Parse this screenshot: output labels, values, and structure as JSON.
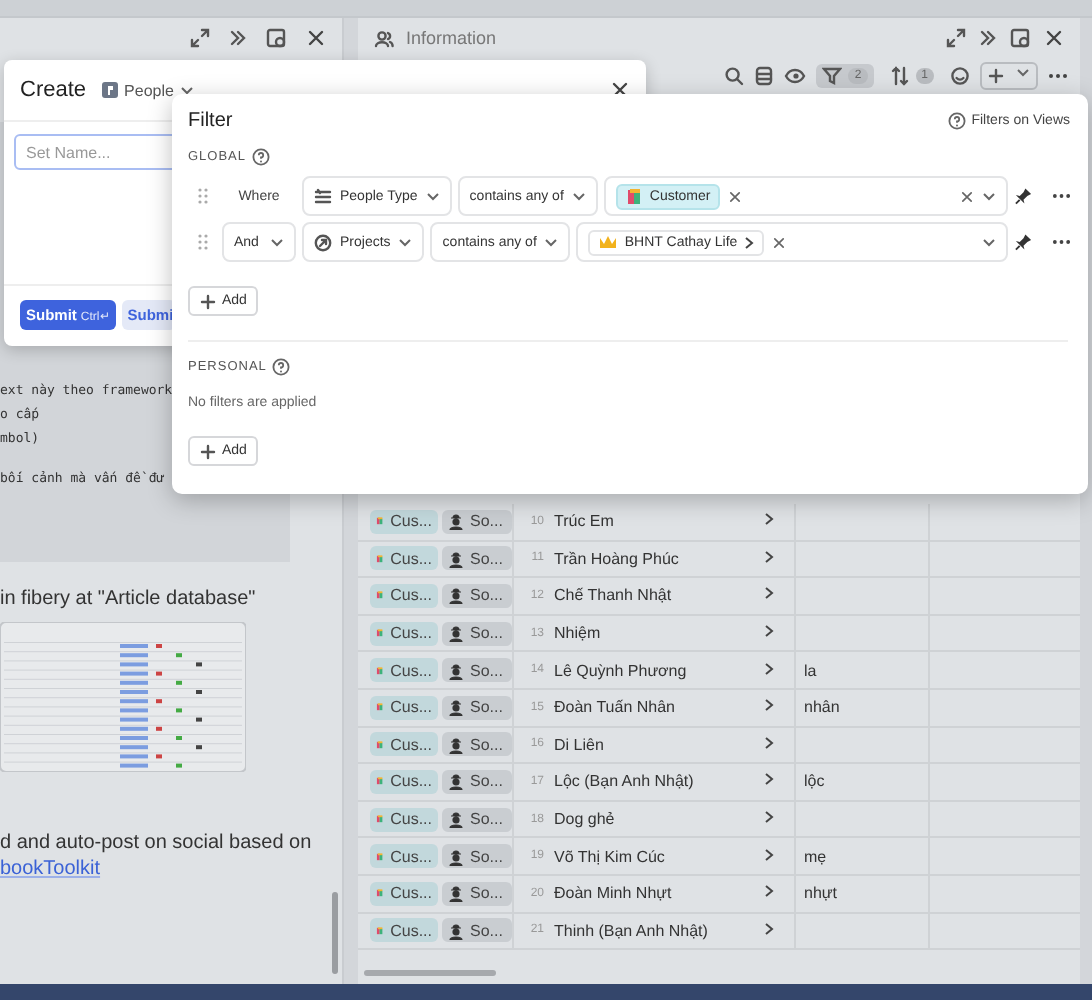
{
  "left_panel": {
    "code_lines": [
      "ext này theo framework",
      "o cấp",
      "mbol)",
      "bối cảnh mà vấn đề đư"
    ],
    "paragraph_top": "in fibery at \"Article database\"",
    "paragraph_bottom": "d and auto-post on social based on",
    "link": "bookToolkit"
  },
  "right_panel": {
    "title": "Information",
    "filter_count": "2",
    "sort_count": "1",
    "rows": [
      {
        "chips": [
          "Cus...",
          "So..."
        ],
        "number": "10",
        "name": "Trúc Em"
      },
      {
        "chips": [
          "Cus...",
          "So..."
        ],
        "number": "11",
        "name": "Trần Hoàng Phúc"
      },
      {
        "chips": [
          "Cus...",
          "So..."
        ],
        "number": "12",
        "name": "Chế Thanh Nhật"
      },
      {
        "chips": [
          "Cus...",
          "So..."
        ],
        "number": "13",
        "name": "Nhiệm"
      },
      {
        "chips": [
          "Cus...",
          "So..."
        ],
        "number": "14",
        "name": "Lê Quỳnh Phương",
        "note": "la"
      },
      {
        "chips": [
          "Cus...",
          "So..."
        ],
        "number": "15",
        "name": "Đoàn Tuấn Nhân",
        "note": "nhân"
      },
      {
        "chips": [
          "Cus...",
          "So..."
        ],
        "number": "16",
        "name": "Di Liên"
      },
      {
        "chips": [
          "Cus...",
          "So..."
        ],
        "number": "17",
        "name": "Lộc (Bạn Anh Nhật)",
        "note": "lộc"
      },
      {
        "chips": [
          "Cus...",
          "So..."
        ],
        "number": "18",
        "name": "Dog ghẻ"
      },
      {
        "chips": [
          "Cus...",
          "So..."
        ],
        "number": "19",
        "name": "Võ Thị Kim Cúc",
        "note": "mẹ"
      },
      {
        "chips": [
          "Cus...",
          "So..."
        ],
        "number": "20",
        "name": "Đoàn Minh Nhựt",
        "note": "nhựt"
      },
      {
        "chips": [
          "Cus...",
          "So..."
        ],
        "number": "21",
        "name": "Thinh (Bạn Anh Nhật)"
      }
    ]
  },
  "create_dialog": {
    "title": "Create",
    "database": "People",
    "name_field": {
      "placeholder": "Set Name..."
    },
    "buttons": [
      {
        "label": "Submit",
        "shortcut": "Ctrl↵",
        "kind": "primary"
      },
      {
        "label": "Submi",
        "kind": "secondary"
      }
    ]
  },
  "filter_dialog": {
    "title": "Filter",
    "help_link": "Filters on Views",
    "global": {
      "heading": "GLOBAL",
      "filters": [
        {
          "conjunction": {
            "label": "Where",
            "kind": "label"
          },
          "field": {
            "label": "People Type",
            "kind": "list"
          },
          "operator": "contains any of",
          "values": [
            {
              "label": "Customer",
              "kind": "tag"
            }
          ],
          "clearable": true
        },
        {
          "conjunction": {
            "label": "And",
            "kind": "select"
          },
          "field": {
            "label": "Projects",
            "kind": "relation"
          },
          "operator": "contains any of",
          "values": [
            {
              "label": "BHNT Cathay Life",
              "kind": "entity"
            }
          ],
          "clearable": false
        }
      ],
      "add_button": "Add"
    },
    "personal": {
      "heading": "PERSONAL",
      "empty_text": "No filters are applied",
      "add_button": "Add"
    }
  }
}
